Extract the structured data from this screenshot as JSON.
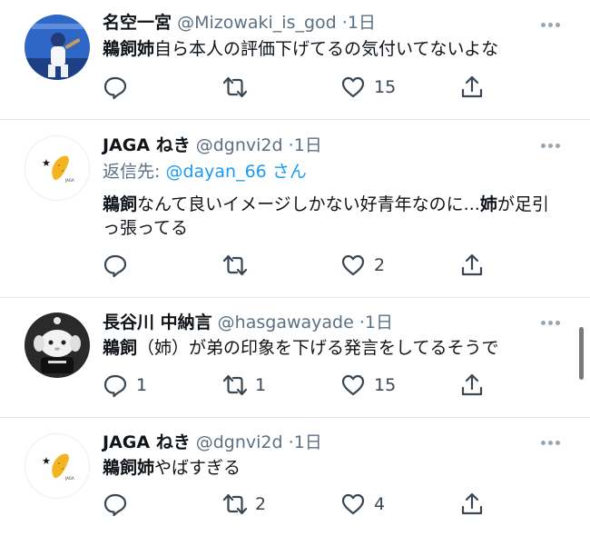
{
  "icons": {
    "more": "more-dots-icon",
    "reply": "reply-icon",
    "retweet": "retweet-icon",
    "like": "heart-icon",
    "share": "share-icon"
  },
  "colors": {
    "link": "#1d9bf0",
    "secondary": "#5b7083",
    "divider": "#e4e8ec"
  },
  "tweets": [
    {
      "name": "名空一宮",
      "handle": "@Mizowaki_is_god",
      "sep": "·",
      "time": "1日",
      "text_bold": "鵜飼姉",
      "text_rest": "自ら本人の評価下げてるの気付いてないよな",
      "replies": "",
      "retweets": "",
      "likes": "15"
    },
    {
      "name": "JAGA ねき",
      "handle": "@dgnvi2d",
      "sep": "·",
      "time": "1日",
      "reply_prefix": "返信先: ",
      "reply_handle": "@dayan_66",
      "reply_suffix": "さん",
      "text_bold": "鵜飼",
      "text_mid": "なんて良いイメージしかない好青年なのに...",
      "text_bold2": "姉",
      "text_rest": "が足引っ張ってる",
      "replies": "",
      "retweets": "",
      "likes": "2"
    },
    {
      "name": "長谷川 中納言",
      "handle": "@hasgawayade",
      "sep": "·",
      "time": "1日",
      "text_bold": "鵜飼",
      "text_rest": "（姉）が弟の印象を下げる発言をしてるそうで",
      "replies": "1",
      "retweets": "1",
      "likes": "15"
    },
    {
      "name": "JAGA ねき",
      "handle": "@dgnvi2d",
      "sep": "·",
      "time": "1日",
      "text_bold": "鵜飼姉",
      "text_rest": "やばすぎる",
      "replies": "",
      "retweets": "2",
      "likes": "4"
    }
  ]
}
